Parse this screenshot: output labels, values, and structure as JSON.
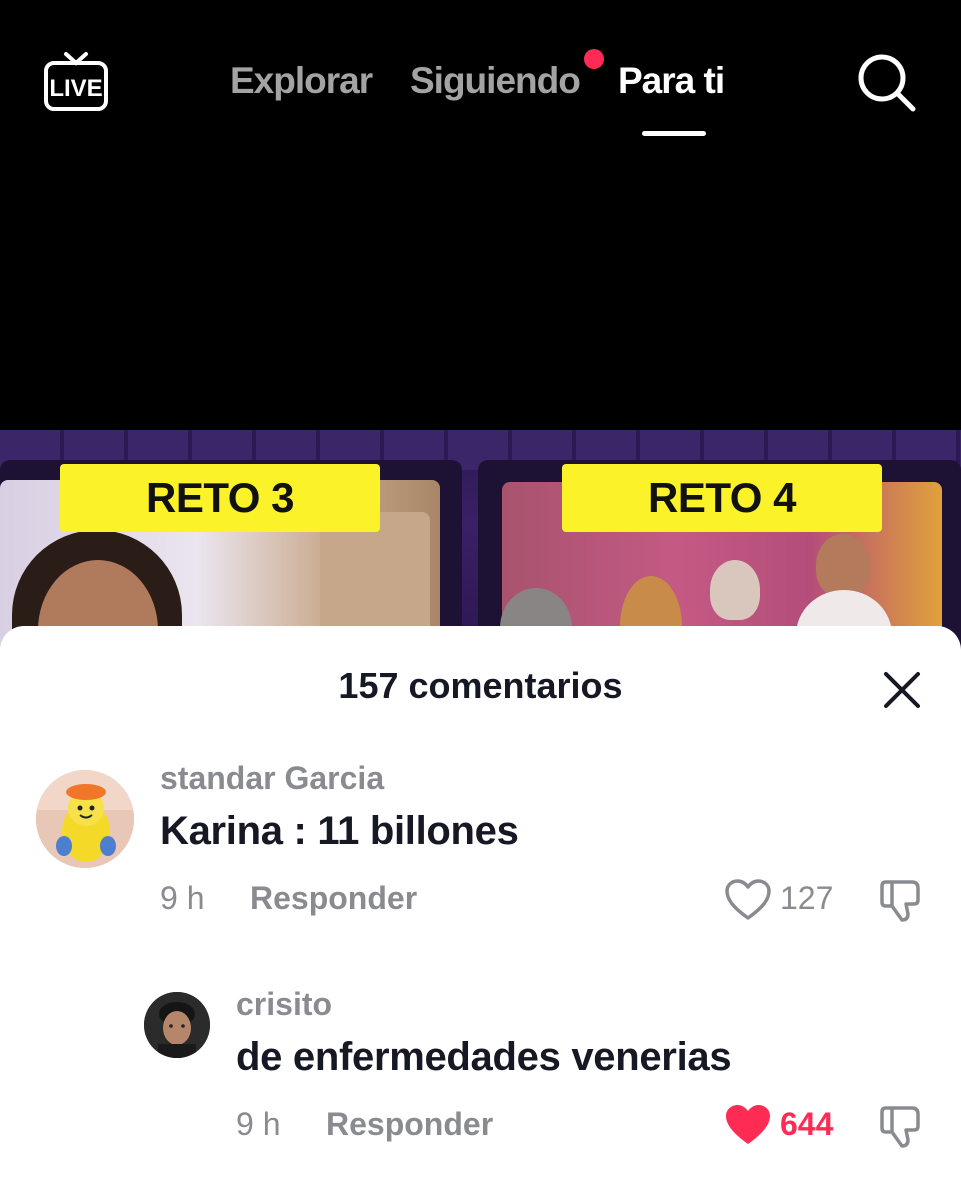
{
  "nav": {
    "live_label": "LIVE",
    "tabs": [
      {
        "label": "Explorar",
        "active": false
      },
      {
        "label": "Siguiendo",
        "active": false,
        "has_notification_dot": true
      },
      {
        "label": "Para ti",
        "active": true
      }
    ],
    "icons": {
      "live": "live-tv-icon",
      "search": "search-icon"
    }
  },
  "video": {
    "badges": [
      "RETO 3",
      "RETO 4"
    ]
  },
  "comments_sheet": {
    "title": "157 comentarios",
    "close_icon": "close-icon",
    "comments": [
      {
        "username": "standar Garcia",
        "text": "Karina : 11 billones",
        "time": "9 h",
        "reply_label": "Responder",
        "likes": "127",
        "liked": false
      },
      {
        "username": "crisito",
        "text": "de enfermedades venerias",
        "time": "9 h",
        "reply_label": "Responder",
        "likes": "644",
        "liked": true,
        "is_reply": true
      }
    ]
  },
  "colors": {
    "accent": "#fe2c55",
    "badge_yellow": "#fbf22a",
    "muted_text": "#8a8b91"
  }
}
